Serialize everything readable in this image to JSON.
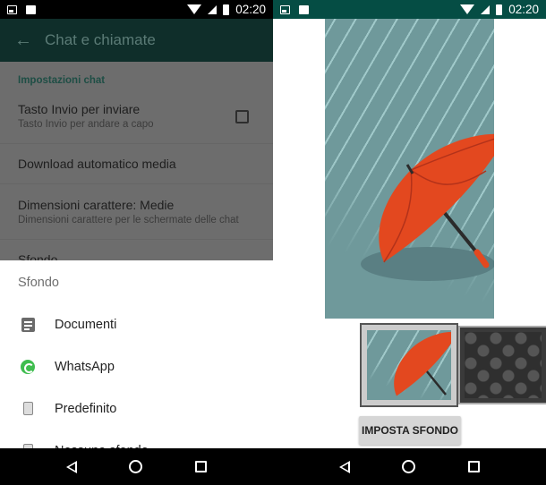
{
  "status_bar": {
    "time": "02:20",
    "left_icons": [
      "image-icon",
      "briefcase-icon"
    ],
    "right_icons": [
      "wifi-icon",
      "signal-icon",
      "battery-icon"
    ]
  },
  "left_screen": {
    "app_bar": {
      "title": "Chat e chiamate",
      "back_icon": "arrow-back-icon"
    },
    "settings": {
      "section_header": "Impostazioni chat",
      "items": [
        {
          "title": "Tasto Invio per inviare",
          "subtitle": "Tasto Invio per andare a capo",
          "checked": false
        },
        {
          "title": "Download automatico media"
        },
        {
          "title": "Dimensioni carattere: Medie",
          "subtitle": "Dimensioni carattere per le schermate delle chat"
        },
        {
          "title": "Sfondo"
        }
      ]
    },
    "bottom_sheet": {
      "title": "Sfondo",
      "items": [
        {
          "label": "Documenti",
          "icon": "document-icon"
        },
        {
          "label": "WhatsApp",
          "icon": "whatsapp-icon"
        },
        {
          "label": "Predefinito",
          "icon": "default-wallpaper-icon"
        },
        {
          "label": "Nessuno sfondo",
          "icon": "no-wallpaper-icon"
        }
      ]
    }
  },
  "right_screen": {
    "preview": {
      "subject": "red umbrella in rain"
    },
    "thumbnails": [
      {
        "name": "umbrella-rain",
        "selected": true
      },
      {
        "name": "dark-damask",
        "selected": false
      }
    ],
    "set_button": "IMPOSTA SFONDO"
  },
  "nav_bar": {
    "icons": [
      "back-icon",
      "home-icon",
      "recents-icon"
    ]
  },
  "colors": {
    "whatsapp_dark": "#054d44",
    "scrim_appbar": "#0f2e2a",
    "accent_green": "#3fbd4f",
    "umbrella_red": "#e3481f",
    "rain_bg": "#6f999b"
  }
}
